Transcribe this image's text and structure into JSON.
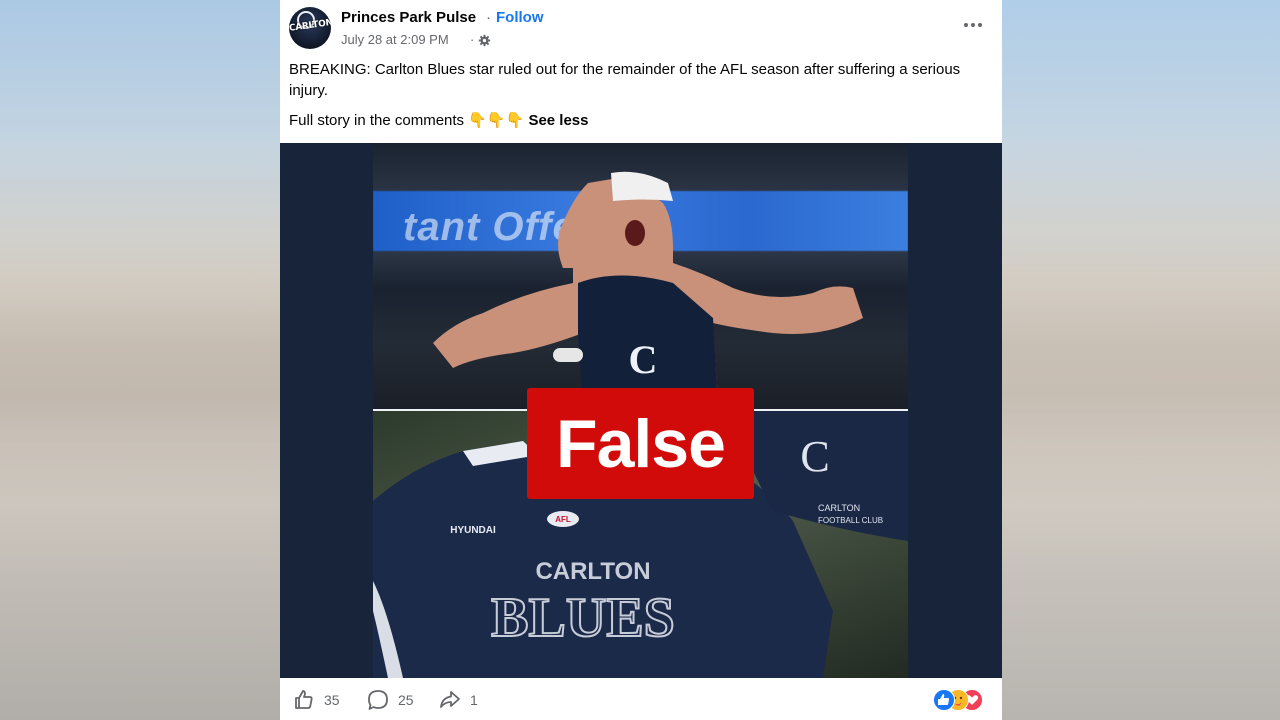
{
  "post": {
    "page_name": "Princes Park Pulse",
    "separator": "·",
    "follow_label": "Follow",
    "timestamp": "July 28 at 2:09 PM",
    "ts_separator": "·",
    "avatar_text": "CARLTON",
    "caption_line1": "BREAKING: Carlton Blues star ruled out for the remainder of the AFL season after suffering a serious injury.",
    "caption_line2": "Full story in the comments",
    "caption_emojis": "👇👇👇",
    "see_less_label": "See less",
    "icons": [
      "gear-icon",
      "more-icon",
      "like-icon",
      "comment-icon",
      "share-icon"
    ]
  },
  "media": {
    "banner_text": "tant Offer",
    "false_label": "False",
    "jersey_line1": "CARLTON",
    "jersey_line2": "BLUES",
    "sponsor": "HYUNDAI",
    "club_label_1": "CARLTON",
    "club_label_2": "FOOTBALL CLUB",
    "afl_badge": "AFL"
  },
  "actions": {
    "likes": "35",
    "comments": "25",
    "shares": "1",
    "reaction_types": [
      "like",
      "care",
      "love"
    ]
  },
  "colors": {
    "link": "#1877f2",
    "false_badge": "#d10a0a",
    "media_bg": "#17243a"
  }
}
